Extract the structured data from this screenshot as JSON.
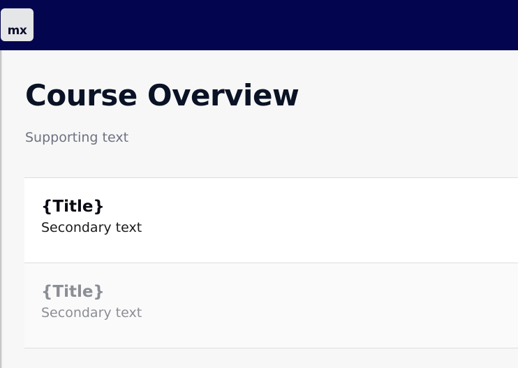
{
  "header": {
    "logo_text": "mx"
  },
  "page": {
    "title": "Course Overview",
    "supporting_text": "Supporting text"
  },
  "list": {
    "items": [
      {
        "title": "{Title}",
        "secondary": "Secondary text",
        "state": "enabled"
      },
      {
        "title": "{Title}",
        "secondary": "Secondary text",
        "state": "disabled"
      }
    ]
  },
  "colors": {
    "topbar": "#03064e",
    "background": "#f7f7f7",
    "title": "#0a1325",
    "muted": "#6d7280",
    "disabled_text": "#8b8e94"
  }
}
